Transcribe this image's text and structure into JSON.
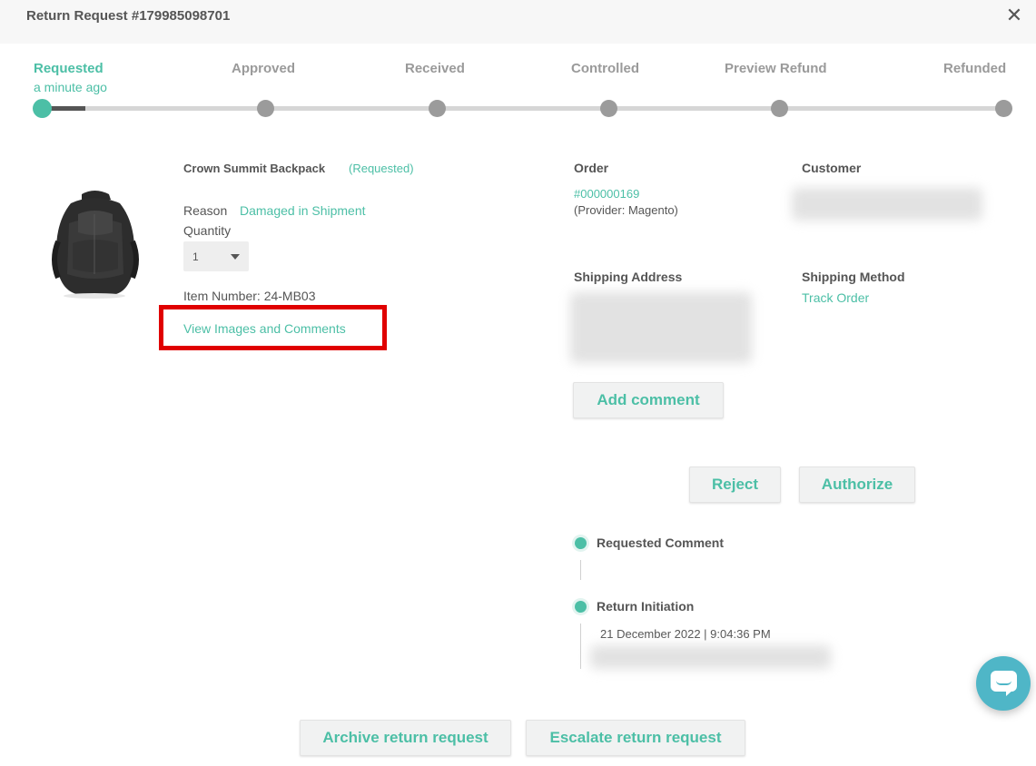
{
  "header": {
    "title": "Return Request #179985098701",
    "close_icon": "close-icon"
  },
  "stepper": {
    "steps": [
      {
        "label": "Requested",
        "active": true
      },
      {
        "label": "Approved",
        "active": false
      },
      {
        "label": "Received",
        "active": false
      },
      {
        "label": "Controlled",
        "active": false
      },
      {
        "label": "Preview Refund",
        "active": false
      },
      {
        "label": "Refunded",
        "active": false
      }
    ],
    "current_sub": "a minute ago",
    "progress": 0.045
  },
  "product": {
    "image_icon": "backpack-image",
    "name": "Crown Summit Backpack",
    "status": "(Requested)",
    "reason_label": "Reason",
    "reason_value": "Damaged in Shipment",
    "quantity_label": "Quantity",
    "quantity_value": "1",
    "item_number": "Item Number: 24-MB03",
    "view_images_link": "View Images and Comments"
  },
  "order": {
    "heading": "Order",
    "number": "#000000169",
    "provider": "(Provider: Magento)"
  },
  "customer": {
    "heading": "Customer"
  },
  "shipping": {
    "address_heading": "Shipping Address",
    "method_heading": "Shipping Method",
    "track_link": "Track Order"
  },
  "actions": {
    "add_comment": "Add comment",
    "reject": "Reject",
    "authorize": "Authorize",
    "archive": "Archive return request",
    "escalate": "Escalate return request"
  },
  "timeline": [
    {
      "title": "Requested Comment"
    },
    {
      "title": "Return Initiation",
      "date": "21 December 2022 | 9:04:36 PM"
    }
  ],
  "colors": {
    "accent": "#4cbfa6",
    "highlight": "#e00000",
    "chat": "#4fb6c7"
  },
  "chat_icon": "chat-icon"
}
